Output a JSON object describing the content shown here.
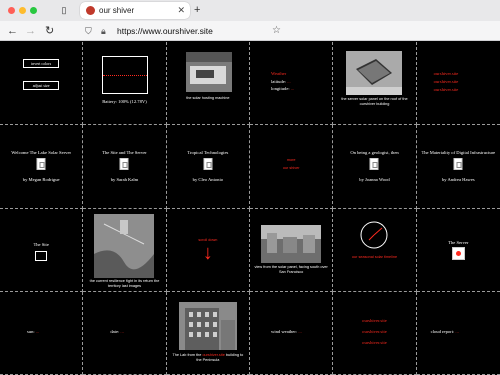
{
  "browser": {
    "tab_title": "our shiver",
    "url": "https://www.ourshiver.site",
    "icons": [
      "close-dot",
      "minimize-dot",
      "maximize-dot",
      "sidebar-icon",
      "tab-close-icon",
      "new-tab-icon",
      "back-icon",
      "forward-icon",
      "reload-icon",
      "shield-icon",
      "lock-icon",
      "bookmark-star-icon"
    ],
    "colors": {
      "close": "#ff5f57",
      "minimize": "#febc2e",
      "maximize": "#28c840",
      "favicon": "#c0392b"
    }
  },
  "page": {
    "accent_color": "#ff2a1f",
    "row1": {
      "controls": {
        "invert_label": "invert colors",
        "adjust_label": "adjust size"
      },
      "battery": {
        "text": "Battery: 100% (12.78V)",
        "bar_value": 0.5
      },
      "photo1": {
        "caption": "the solar hosting machine"
      },
      "weather": {
        "header": "Weather",
        "latitude_label": "latitude:",
        "latitude_value": "...",
        "longitude_label": "longitude:",
        "longitude_value": "..."
      },
      "photo2": {
        "caption": "the server solar panel on the roof of the ourshiver building"
      },
      "links": [
        "ourshiver.site",
        "ourshiver.site",
        "ourshiver.site"
      ]
    },
    "row2": {
      "articles": [
        {
          "title": "Welcome The Lake Solar Server",
          "author": "by Megan Rodrigue"
        },
        {
          "title": "The Site and The Server",
          "author": "by Sarah Kalm"
        },
        {
          "title": "Tropical Technologies",
          "author": "by Cleo Antonio"
        },
        {
          "title": "On being a geologist, then",
          "author": "by Joanna Wood"
        },
        {
          "title": "The Materiality of Digital Infrastructure",
          "author": "by Andrea Hawes"
        }
      ],
      "center_links": [
        "more",
        "our shiver"
      ]
    },
    "row3": {
      "site": {
        "label": "The Site"
      },
      "photo3": {
        "caption": "the current resilience fight in its return the territory last images"
      },
      "down": {
        "label": "scroll down",
        "arrow": "↓"
      },
      "photo4": {
        "caption": "view from the solar panel, facing south over San Francisco"
      },
      "circle": {
        "caption": "our seasonal solar timeline"
      },
      "server": {
        "label": "The Server"
      }
    },
    "row4": {
      "sun": {
        "label": "sun:",
        "value": "..."
      },
      "date": {
        "label": "date:",
        "value": "..."
      },
      "photo5": {
        "caption_pre": "The Lab from the ",
        "caption_link": "ourshiver.site",
        "caption_post": " building to the Peninsula"
      },
      "wind": {
        "label": "wind weather:",
        "value": "..."
      },
      "stack": [
        "ourshiver.site",
        "ourshiver.site",
        "ourshiver.site"
      ],
      "cloud": {
        "label": "cloud report:",
        "value": "..."
      }
    }
  }
}
